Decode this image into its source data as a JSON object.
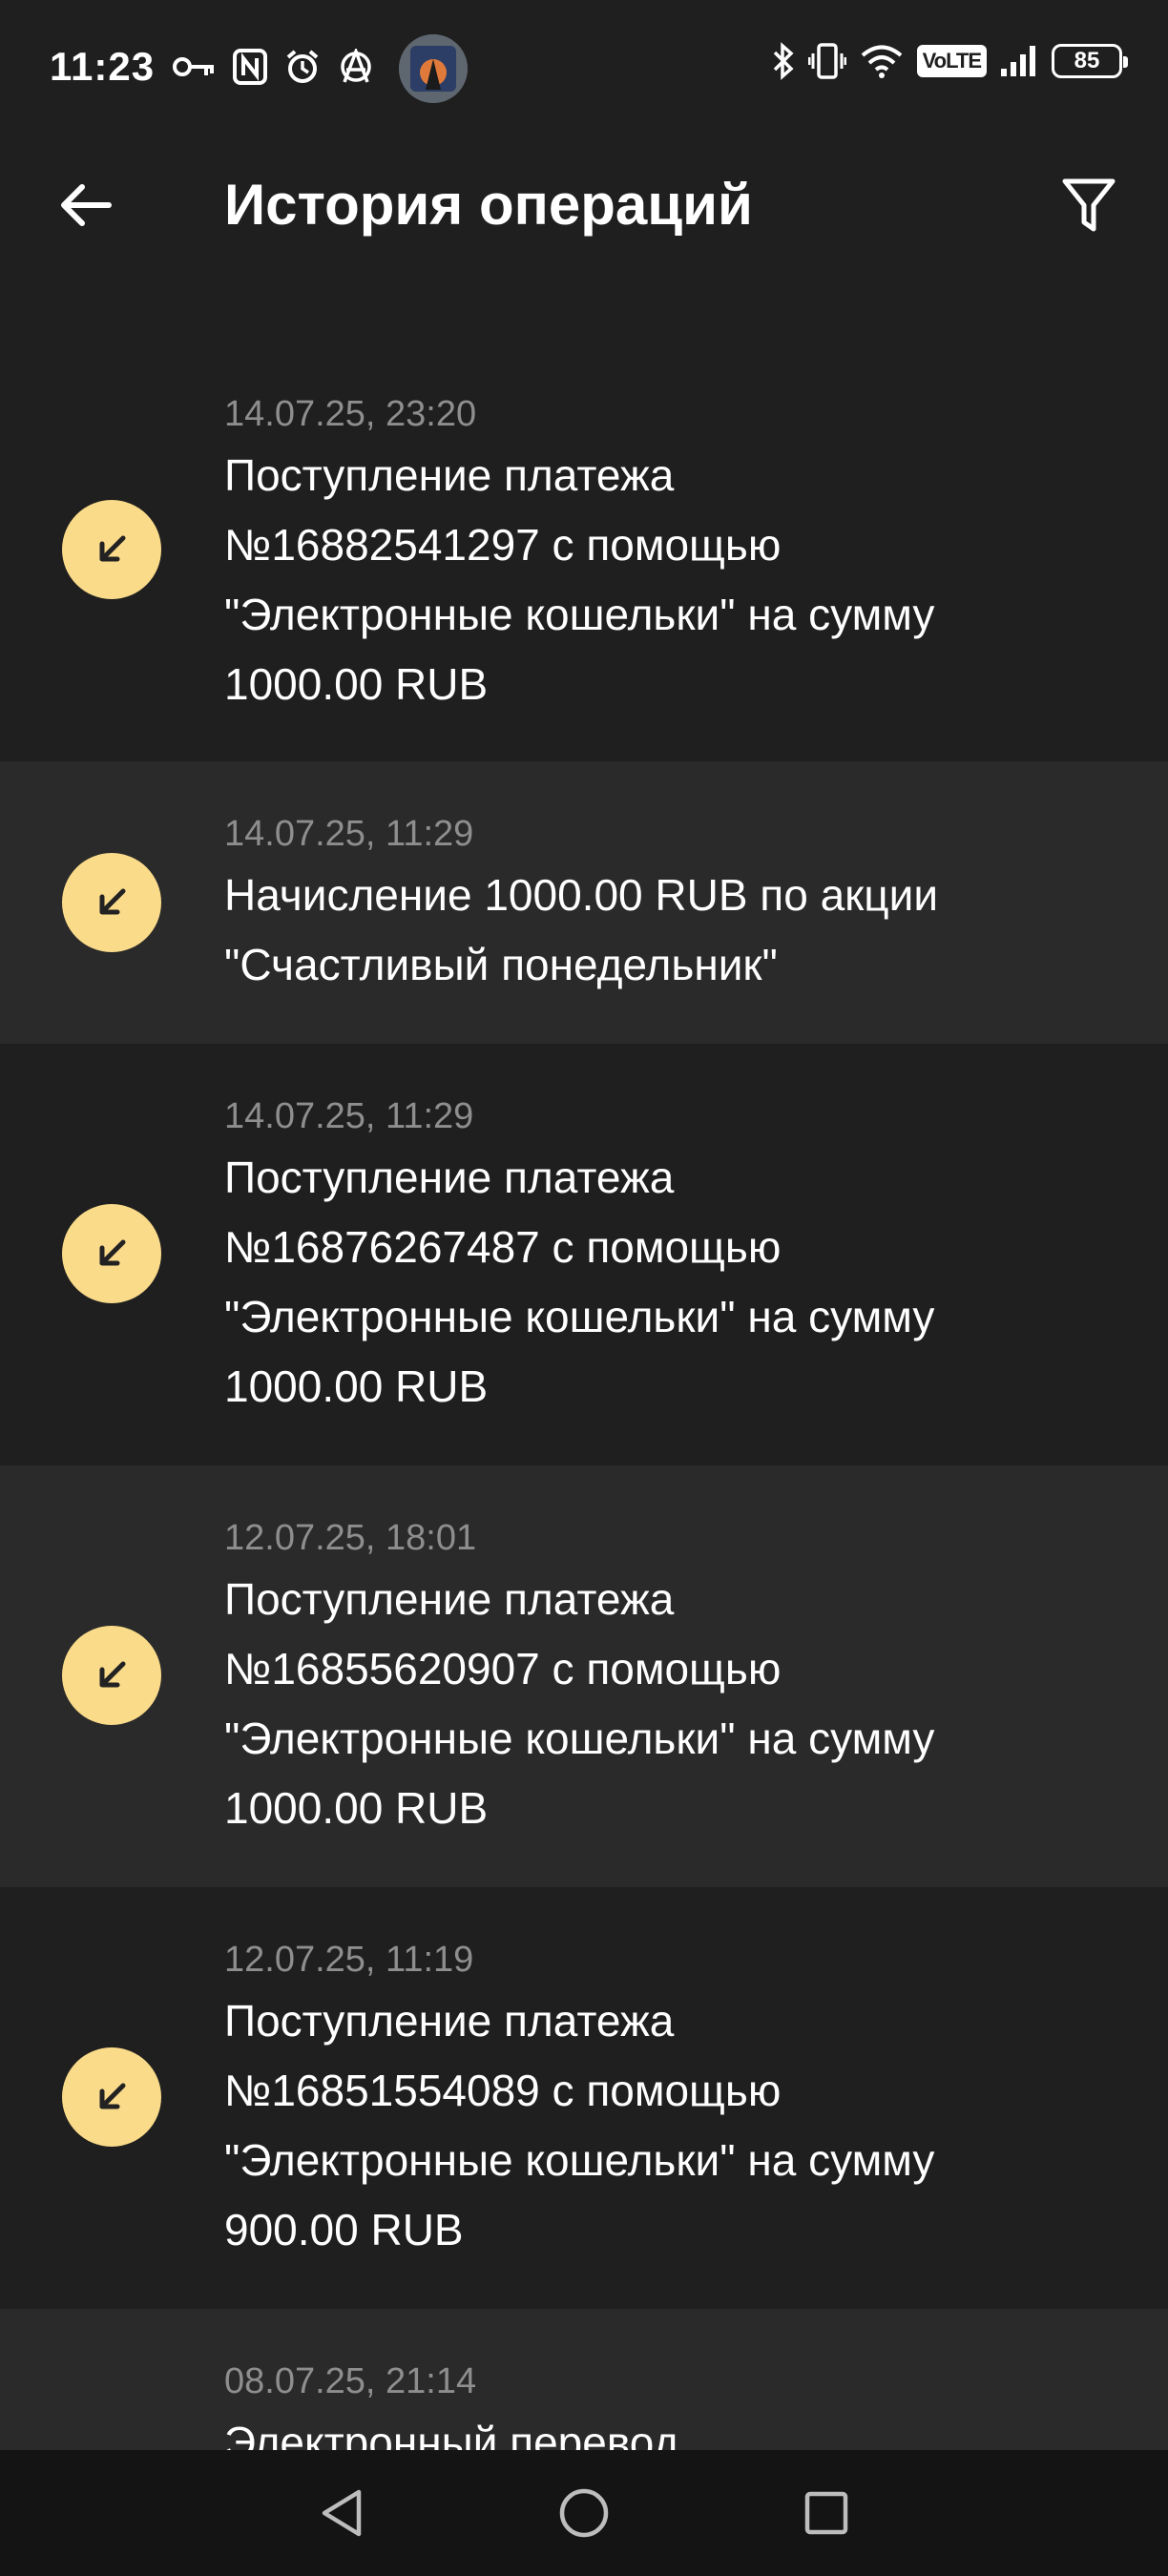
{
  "status_bar": {
    "time": "11:23",
    "battery": "85",
    "volte": "VoLTE",
    "icons": [
      "key-icon",
      "nfc-icon",
      "alarm-icon",
      "anarchy-icon",
      "bluetooth-icon",
      "vibrate-icon",
      "wifi-icon",
      "volte-icon",
      "signal-icon",
      "battery-icon"
    ]
  },
  "header": {
    "title": "История операций"
  },
  "operations": [
    {
      "date": "14.07.25, 23:20",
      "lines": [
        "Поступление платежа",
        "№16882541297 с помощью",
        "\"Электронные кошельки\" на сумму",
        "1000.00 RUB"
      ]
    },
    {
      "date": "14.07.25, 11:29",
      "lines": [
        "Начисление 1000.00 RUB по акции",
        "\"Счастливый понедельник\""
      ]
    },
    {
      "date": "14.07.25, 11:29",
      "lines": [
        "Поступление платежа",
        "№16876267487 с помощью",
        "\"Электронные кошельки\" на сумму",
        "1000.00 RUB"
      ]
    },
    {
      "date": "12.07.25, 18:01",
      "lines": [
        "Поступление платежа",
        "№16855620907 с помощью",
        "\"Электронные кошельки\" на сумму",
        "1000.00 RUB"
      ]
    },
    {
      "date": "12.07.25, 11:19",
      "lines": [
        "Поступление платежа",
        "№16851554089 с помощью",
        "\"Электронные кошельки\" на сумму",
        "900.00 RUB"
      ]
    },
    {
      "date": "08.07.25, 21:14",
      "lines": [
        "Электронный перевод"
      ]
    }
  ],
  "colors": {
    "background": "#1f1f1f",
    "alt_row": "#2a2a2a",
    "icon_circle": "#fadb8a",
    "date_text": "#8e8e8e",
    "nav_bar": "#141414"
  }
}
